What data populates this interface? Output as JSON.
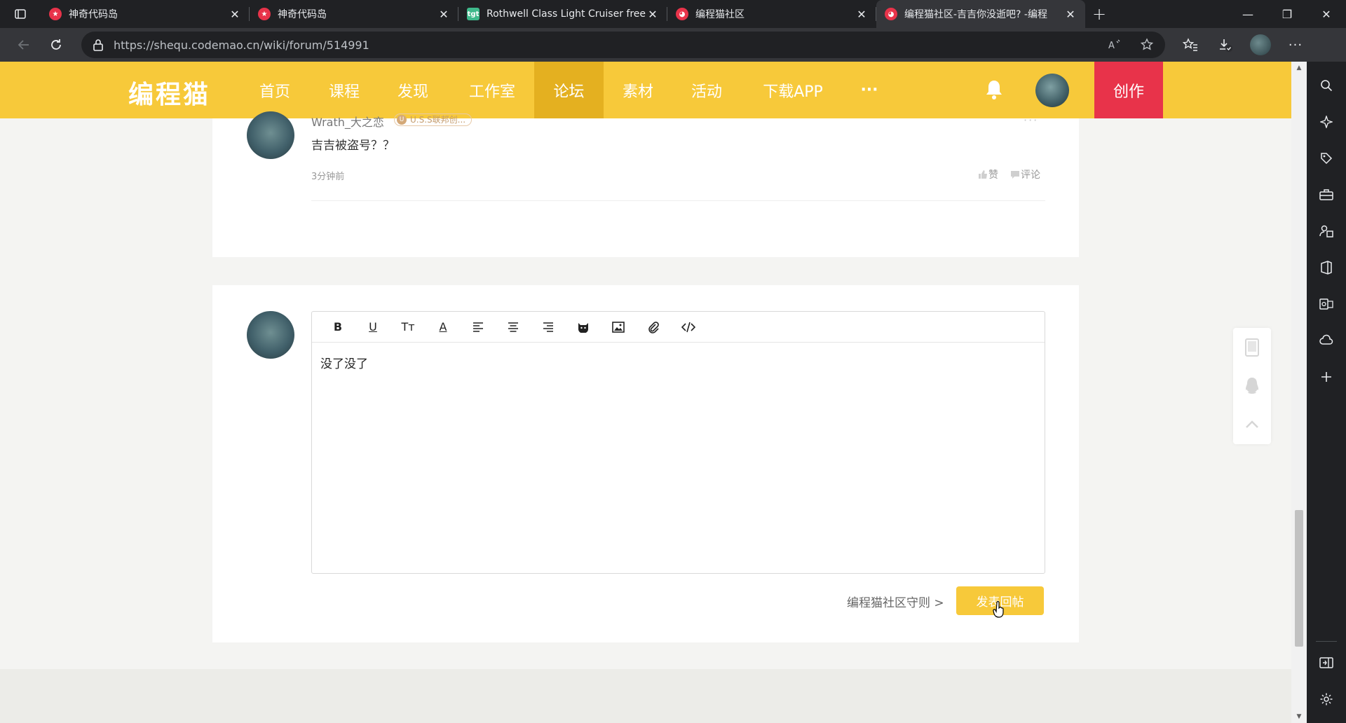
{
  "browser": {
    "tabs": [
      {
        "title": "神奇代码岛",
        "favicon_color": "#e8334a",
        "active": false
      },
      {
        "title": "神奇代码岛",
        "favicon_color": "#e8334a",
        "active": false
      },
      {
        "title": "Rothwell Class Light Cruiser free",
        "favicon_color": "#3fb98b",
        "favicon_text": "tgt",
        "active": false
      },
      {
        "title": "编程猫社区",
        "favicon_color": "#e8334a",
        "active": false
      },
      {
        "title": "编程猫社区-吉吉你没逝吧? -编程",
        "favicon_color": "#e8334a",
        "active": true
      }
    ],
    "url": "https://shequ.codemao.cn/wiki/forum/514991"
  },
  "site": {
    "logo": "编程猫",
    "nav": [
      {
        "label": "首页",
        "active": false
      },
      {
        "label": "课程",
        "active": false
      },
      {
        "label": "发现",
        "active": false
      },
      {
        "label": "工作室",
        "active": false
      },
      {
        "label": "论坛",
        "active": true
      },
      {
        "label": "素材",
        "active": false
      },
      {
        "label": "活动",
        "active": false
      },
      {
        "label": "下载APP",
        "active": false
      },
      {
        "label": "···",
        "active": false
      }
    ],
    "create_label": "创作",
    "brand_color": "#f7c93a",
    "create_color": "#e8334a"
  },
  "reply": {
    "user_name": "Wrath_大之恋",
    "badge": "U.S.S联邦创...",
    "text": "吉吉被盗号？？",
    "time": "3分钟前",
    "like_label": "赞",
    "comment_label": "评论"
  },
  "editor": {
    "content": "没了没了",
    "tools": [
      "B",
      "U",
      "Tт",
      "A",
      "align-left",
      "align-center",
      "align-right",
      "cat-emoji",
      "image",
      "attachment",
      "code"
    ]
  },
  "actions": {
    "rules_link": "编程猫社区守则 >",
    "submit_label": "发表回帖"
  }
}
